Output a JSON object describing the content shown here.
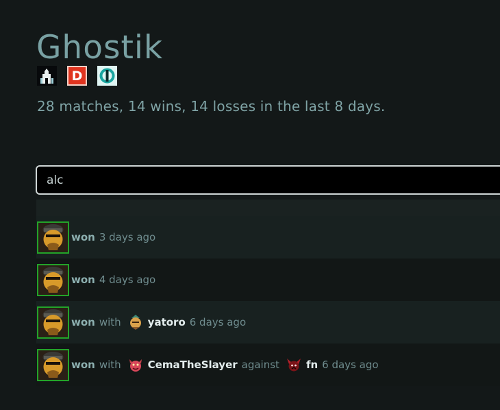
{
  "player": {
    "name": "Ghostik",
    "badges": [
      {
        "icon": "tower-icon",
        "label": ""
      },
      {
        "icon": "dotabuff-d-icon",
        "label": "D"
      },
      {
        "icon": "opendota-icon",
        "label": ""
      }
    ],
    "summary": "28 matches, 14 wins, 14 losses in the last 8 days."
  },
  "search": {
    "value": "alc"
  },
  "matches": [
    {
      "hero_icon": "alchemist-hero-icon",
      "result": "won",
      "time": "3 days ago"
    },
    {
      "hero_icon": "alchemist-hero-icon",
      "result": "won",
      "time": "4 days ago"
    },
    {
      "hero_icon": "alchemist-hero-icon",
      "result": "won",
      "with_label": "with",
      "ally": "yatoro",
      "ally_icon": "monkey-king-hero-icon",
      "time": "6 days ago"
    },
    {
      "hero_icon": "alchemist-hero-icon",
      "result": "won",
      "with_label": "with",
      "ally": "CemaTheSlayer",
      "ally_icon": "demon-hero-icon",
      "against_label": "against",
      "enemy": "fn",
      "enemy_icon": "shadow-demon-hero-icon",
      "time": "6 days ago"
    }
  ],
  "colors": {
    "win_border": "#23a329",
    "title": "#79a1a3",
    "background": "#131818"
  }
}
